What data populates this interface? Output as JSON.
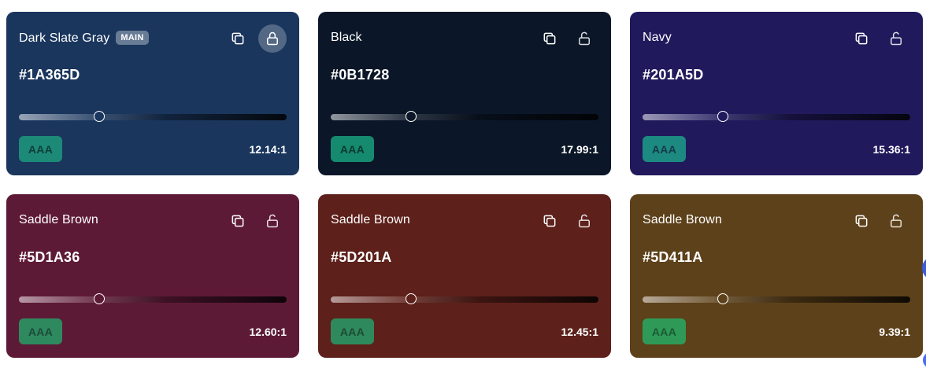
{
  "cards": [
    {
      "name": "Dark Slate Gray",
      "badge": "MAIN",
      "hex": "#1A365D",
      "bg": "#1A365D",
      "locked": true,
      "rating": "AAA",
      "ratio": "12.14:1",
      "slider_fraction": 0.3,
      "rating_bg": "#1d8a78",
      "rating_fg": "#0d3d3a"
    },
    {
      "name": "Black",
      "hex": "#0B1728",
      "bg": "#0B1728",
      "locked": false,
      "rating": "AAA",
      "ratio": "17.99:1",
      "slider_fraction": 0.3,
      "rating_bg": "#158a6e",
      "rating_fg": "#0a3a32"
    },
    {
      "name": "Navy",
      "hex": "#201A5D",
      "bg": "#201A5D",
      "locked": false,
      "rating": "AAA",
      "ratio": "15.36:1",
      "slider_fraction": 0.3,
      "rating_bg": "#1c8a80",
      "rating_fg": "#153a4a"
    },
    {
      "name": "Saddle Brown",
      "hex": "#5D1A36",
      "bg": "#5D1A36",
      "locked": false,
      "rating": "AAA",
      "ratio": "12.60:1",
      "slider_fraction": 0.3,
      "rating_bg": "#2e8a5e",
      "rating_fg": "#1d4a36"
    },
    {
      "name": "Saddle Brown",
      "hex": "#5D201A",
      "bg": "#5D201A",
      "locked": false,
      "rating": "AAA",
      "ratio": "12.45:1",
      "slider_fraction": 0.3,
      "rating_bg": "#2e8a5c",
      "rating_fg": "#1d4a34"
    },
    {
      "name": "Saddle Brown",
      "hex": "#5D411A",
      "bg": "#5D411A",
      "locked": false,
      "rating": "AAA",
      "ratio": "9.39:1",
      "slider_fraction": 0.3,
      "rating_bg": "#2f9a58",
      "rating_fg": "#1a5a34"
    }
  ],
  "icons": {
    "copy": "copy-icon",
    "lock": "lock-icon",
    "unlock": "unlock-icon"
  }
}
